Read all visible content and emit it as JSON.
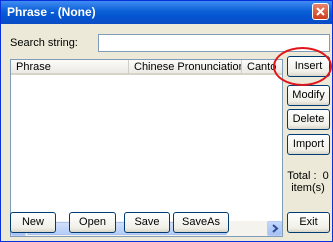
{
  "window": {
    "title": "Phrase - (None)"
  },
  "search": {
    "label": "Search string:",
    "value": ""
  },
  "list": {
    "columns": [
      "Phrase",
      "Chinese Pronunciation",
      "Canto"
    ]
  },
  "side_buttons": {
    "insert": "Insert",
    "modify": "Modify",
    "delete": "Delete",
    "import": "Import"
  },
  "total": {
    "label": "Total :",
    "count": "0",
    "unit": "item(s)"
  },
  "bottom_buttons": {
    "new": "New",
    "open": "Open",
    "save": "Save",
    "saveas": "SaveAs",
    "exit": "Exit"
  },
  "highlight_color": "#e0171a"
}
